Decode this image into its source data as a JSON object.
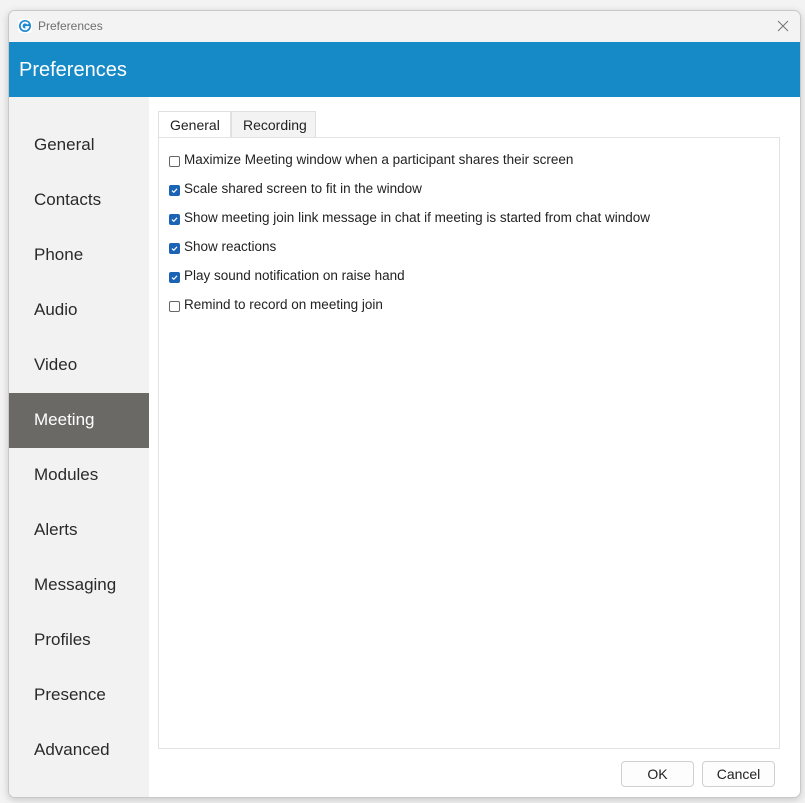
{
  "window": {
    "title": "Preferences",
    "app_icon": "app-logo-icon",
    "close_icon": "close-icon"
  },
  "header": {
    "title": "Preferences"
  },
  "sidebar": {
    "active": "Meeting",
    "items": [
      {
        "label": "General"
      },
      {
        "label": "Contacts"
      },
      {
        "label": "Phone"
      },
      {
        "label": "Audio"
      },
      {
        "label": "Video"
      },
      {
        "label": "Meeting"
      },
      {
        "label": "Modules"
      },
      {
        "label": "Alerts"
      },
      {
        "label": "Messaging"
      },
      {
        "label": "Profiles"
      },
      {
        "label": "Presence"
      },
      {
        "label": "Advanced"
      }
    ]
  },
  "tabs": [
    {
      "label": "General",
      "active": true
    },
    {
      "label": "Recording",
      "active": false
    }
  ],
  "options": [
    {
      "label": "Maximize Meeting window when a participant shares their screen",
      "checked": false
    },
    {
      "label": "Scale shared screen to fit in the window",
      "checked": true
    },
    {
      "label": "Show meeting join link message in chat if meeting is started from chat window",
      "checked": true
    },
    {
      "label": "Show reactions",
      "checked": true
    },
    {
      "label": "Play sound notification on raise hand",
      "checked": true
    },
    {
      "label": "Remind to record on meeting join",
      "checked": false
    }
  ],
  "buttons": {
    "ok": "OK",
    "cancel": "Cancel"
  },
  "colors": {
    "header": "#168ac7",
    "active_sidebar": "#6b6966",
    "checkbox": "#1a63b5"
  }
}
